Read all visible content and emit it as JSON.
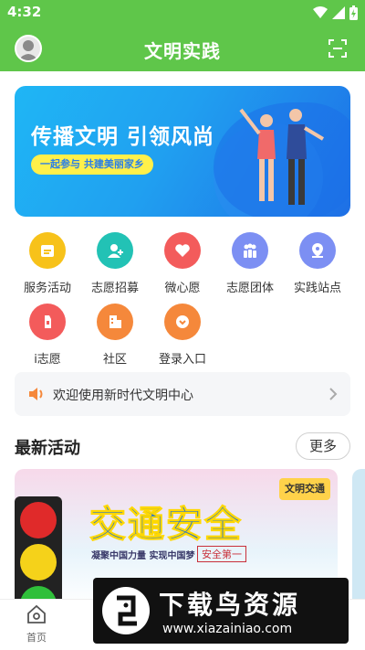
{
  "status_bar": {
    "time": "4:32"
  },
  "header": {
    "title": "文明实践"
  },
  "banner": {
    "title": "传播文明 引领风尚",
    "subtitle": "一起参与 共建美丽家乡"
  },
  "grid": [
    {
      "label": "服务活动",
      "color": "#f7c21a",
      "icon": "calendar-icon"
    },
    {
      "label": "志愿招募",
      "color": "#22c2b5",
      "icon": "user-add-icon"
    },
    {
      "label": "微心愿",
      "color": "#f35b5b",
      "icon": "heart-icon"
    },
    {
      "label": "志愿团体",
      "color": "#7c8ff3",
      "icon": "group-icon"
    },
    {
      "label": "实践站点",
      "color": "#7c8ff3",
      "icon": "location-icon"
    },
    {
      "label": "i志愿",
      "color": "#f35b5b",
      "icon": "hand-icon"
    },
    {
      "label": "社区",
      "color": "#f5883b",
      "icon": "building-icon"
    },
    {
      "label": "登录入口",
      "color": "#f5883b",
      "icon": "login-icon"
    }
  ],
  "notice": {
    "text": "欢迎使用新时代文明中心"
  },
  "latest": {
    "title": "最新活动",
    "more": "更多"
  },
  "activity_card": {
    "tag": "文明交通",
    "poster_title": "交通安全",
    "poster_subtitle": "凝聚中国力量 实现中国梦",
    "poster_safe": "安全第一"
  },
  "bottom_nav": {
    "home": "首页"
  },
  "watermark": {
    "main": "下载鸟资源",
    "url": "www.xiazainiao.com"
  }
}
